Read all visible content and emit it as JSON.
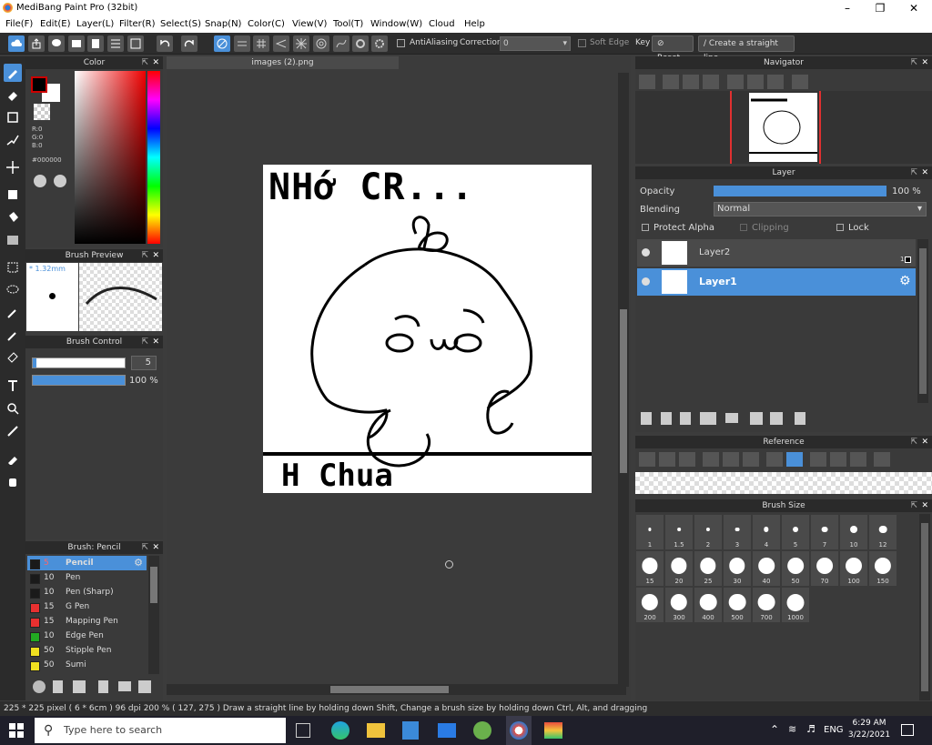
{
  "window": {
    "title": "MediBang Paint Pro (32bit)"
  },
  "menu": [
    "File(F)",
    "Edit(E)",
    "Layer(L)",
    "Filter(R)",
    "Select(S)",
    "Snap(N)",
    "Color(C)",
    "View(V)",
    "Tool(T)",
    "Window(W)",
    "Cloud",
    "Help"
  ],
  "toolbar": {
    "antialiasing": "AntiAliasing",
    "correction_label": "Correction",
    "correction_value": "0",
    "soft_edge": "Soft Edge",
    "key": "Key",
    "reset": "Reset",
    "straight_line": "Create a straight line"
  },
  "color_panel": {
    "title": "Color",
    "r": "R:0",
    "g": "G:0",
    "b": "B:0",
    "hex": "#000000",
    "fg": "#000000",
    "bg": "#ffffff"
  },
  "brush_preview": {
    "title": "Brush Preview",
    "size": "* 1.32mm"
  },
  "brush_control": {
    "title": "Brush Control",
    "size_value": "5",
    "opacity_value": "100 %",
    "size_fraction": 0.04,
    "opacity_fraction": 1.0
  },
  "brush_list": {
    "title": "Brush: Pencil",
    "items": [
      {
        "size": "5",
        "name": "Pencil",
        "color": "#1a1a1a"
      },
      {
        "size": "10",
        "name": "Pen",
        "color": "#1a1a1a"
      },
      {
        "size": "10",
        "name": "Pen (Sharp)",
        "color": "#1a1a1a"
      },
      {
        "size": "15",
        "name": "G Pen",
        "color": "#e83030"
      },
      {
        "size": "15",
        "name": "Mapping Pen",
        "color": "#e83030"
      },
      {
        "size": "10",
        "name": "Edge Pen",
        "color": "#22aa22"
      },
      {
        "size": "50",
        "name": "Stipple Pen",
        "color": "#f0e020"
      },
      {
        "size": "50",
        "name": "Sumi",
        "color": "#f0e020"
      }
    ]
  },
  "document": {
    "tab": "images (2).png",
    "canvas_text_top": "NHớ CR...",
    "canvas_text_bottom": "H Chua"
  },
  "navigator": {
    "title": "Navigator"
  },
  "layer_panel": {
    "title": "Layer",
    "opacity_label": "Opacity",
    "opacity_value": "100 %",
    "blending_label": "Blending",
    "blending_value": "Normal",
    "protect_alpha": "Protect Alpha",
    "clipping": "Clipping",
    "lock": "Lock",
    "layers": [
      {
        "name": "Layer2",
        "badge": "1"
      },
      {
        "name": "Layer1"
      }
    ]
  },
  "reference": {
    "title": "Reference"
  },
  "brush_size": {
    "title": "Brush Size",
    "sizes": [
      "1",
      "1.5",
      "2",
      "3",
      "4",
      "5",
      "7",
      "10",
      "12",
      "15",
      "20",
      "25",
      "30",
      "40",
      "50",
      "70",
      "100",
      "150",
      "200",
      "300",
      "400",
      "500",
      "700",
      "1000"
    ]
  },
  "status": {
    "text": "225 * 225 pixel  ( 6 * 6cm )  96 dpi  200 %  ( 127, 275 )  Draw a straight line by holding down Shift, Change a brush size by holding down Ctrl, Alt, and dragging"
  },
  "taskbar": {
    "search_placeholder": "Type here to search",
    "lang": "ENG",
    "time": "6:29 AM",
    "date": "3/22/2021"
  }
}
